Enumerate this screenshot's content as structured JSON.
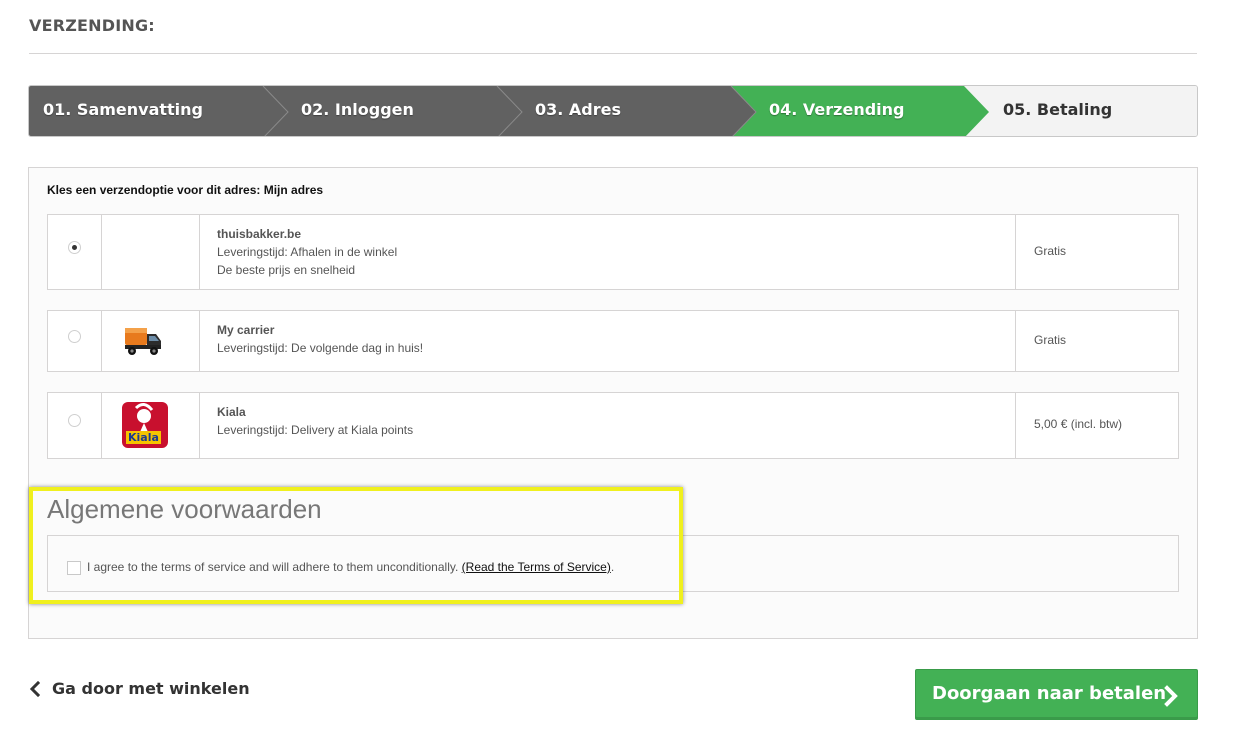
{
  "page": {
    "heading": "VERZENDING:"
  },
  "steps": [
    {
      "label": "01. Samenvatting",
      "state": "done"
    },
    {
      "label": "02. Inloggen",
      "state": "done"
    },
    {
      "label": "03. Adres",
      "state": "done"
    },
    {
      "label": "04. Verzending",
      "state": "current"
    },
    {
      "label": "05. Betaling",
      "state": "todo"
    }
  ],
  "colors": {
    "step_done": "#616161",
    "step_current": "#43b155",
    "step_todo": "#f3f3f3",
    "highlight": "#f0f01e",
    "button": "#43b155"
  },
  "shipping": {
    "title": "Kles een verzendoptie voor dit adres: Mijn adres",
    "carriers": [
      {
        "name": "thuisbakker.be",
        "line1": "Leveringstijd: Afhalen in de winkel",
        "line2": "De beste prijs en snelheid",
        "price": "Gratis",
        "selected": true,
        "icon": "none"
      },
      {
        "name": "My carrier",
        "line1": "Leveringstijd: De volgende dag in huis!",
        "price": "Gratis",
        "selected": false,
        "icon": "truck-icon"
      },
      {
        "name": "Kiala",
        "line1": "Leveringstijd: Delivery at Kiala points",
        "price": "5,00 € (incl. btw)",
        "selected": false,
        "icon": "kiala-logo",
        "logo_text": "Kiala"
      }
    ]
  },
  "terms": {
    "title": "Algemene voorwaarden",
    "text": "I agree to the terms of service and will adhere to them unconditionally.",
    "link": "(Read the Terms of Service)",
    "after": ".",
    "checked": false
  },
  "footer": {
    "continue_label": "Ga door met winkelen",
    "pay_label": "Doorgaan naar betalen"
  }
}
